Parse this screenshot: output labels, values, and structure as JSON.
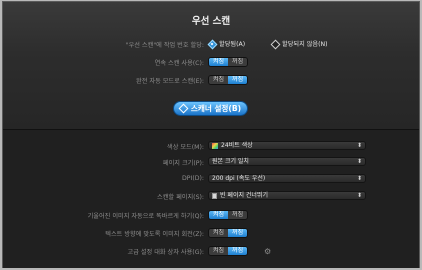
{
  "dialog": {
    "title": "우선 스캔",
    "button_label": "스캐너 설정(B)"
  },
  "top_settings": {
    "job_separation": {
      "label": "\"우선 스캔\"에 작업 번호 할당:",
      "options": [
        {
          "label": "할당됨(A)",
          "selected": true
        },
        {
          "label": "할당되지 않음(N)",
          "selected": false
        }
      ]
    },
    "continuous_scan": {
      "label": "연속 스캔 사용(C):",
      "on_label": "켜짐",
      "off_label": "꺼짐",
      "value": "on"
    },
    "full_auto": {
      "label": "완전 자동 모드로 스캔(E):",
      "on_label": "켜짐",
      "off_label": "꺼짐",
      "value": "off"
    }
  },
  "bottom_settings": {
    "color_mode": {
      "label": "색상 모드(M):",
      "value": "24비트 색상",
      "icon": "color-swatch-icon"
    },
    "page_size": {
      "label": "페이지 크기(P):",
      "value": "원본 크기 일치"
    },
    "dpi": {
      "label": "DPI(D):",
      "value": "200 dpi (속도 우선)"
    },
    "scan_pages": {
      "label": "스캔할 페이지(S):",
      "value": "빈 페이지 건너뛰기",
      "icon": "page-icon"
    },
    "deskew": {
      "label": "기울어진 이미지 자동으로 똑바르게 하기(Q):",
      "on_label": "켜짐",
      "off_label": "꺼짐",
      "value": "on"
    },
    "text_rotate": {
      "label": "텍스트 방향에 맞도록 이미지 회전(Z):",
      "on_label": "켜짐",
      "off_label": "꺼짐",
      "value": "off"
    },
    "advanced_dialog": {
      "label": "고급 설정 대화 상자 사용(G):",
      "on_label": "켜짐",
      "off_label": "꺼짐",
      "value": "off"
    }
  },
  "colors": {
    "accent": "#1e7fd0",
    "background_top": "#2d2d2d",
    "background_bottom": "#202020"
  }
}
